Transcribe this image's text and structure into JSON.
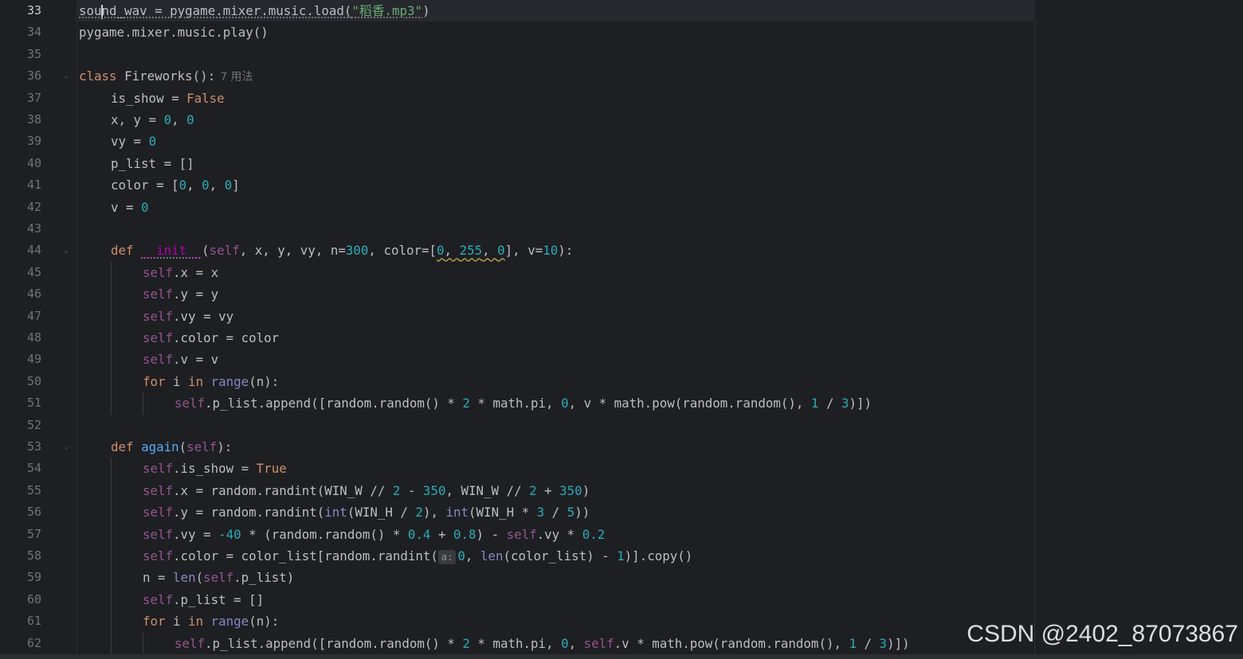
{
  "colors": {
    "background": "#1e1f22",
    "keyword": "#cf8e6d",
    "self": "#94558d",
    "number": "#2aacb8",
    "string": "#6aab73",
    "function_def": "#56a8f5",
    "builtin": "#8888c6",
    "magic_method": "#b200b2",
    "text": "#bcbec4"
  },
  "gutter": {
    "line_numbers": [
      "33",
      "34",
      "35",
      "36",
      "37",
      "38",
      "39",
      "40",
      "41",
      "42",
      "43",
      "44",
      "45",
      "46",
      "47",
      "48",
      "49",
      "50",
      "51",
      "52",
      "53",
      "54",
      "55",
      "56",
      "57",
      "58",
      "59",
      "60",
      "61",
      "62"
    ]
  },
  "inline_hints": {
    "usages": "7 用法",
    "param_a": "a:"
  },
  "code": {
    "l33": {
      "a": "sou",
      "b": "nd_wav = pygame.mixer.music.load(",
      "s": "\"稻香.mp3\"",
      "e": ")"
    },
    "l34": {
      "a": "pygame.mixer.music.play()"
    },
    "l36": {
      "kw": "class",
      "name": " Fireworks():"
    },
    "l37": {
      "a": "is_show = ",
      "v": "False"
    },
    "l38": {
      "a": "x, y = ",
      "n1": "0",
      "c": ", ",
      "n2": "0"
    },
    "l39": {
      "a": "vy = ",
      "n": "0"
    },
    "l40": {
      "a": "p_list = []"
    },
    "l41": {
      "a": "color = [",
      "n1": "0",
      "c1": ", ",
      "n2": "0",
      "c2": ", ",
      "n3": "0",
      "e": "]"
    },
    "l42": {
      "a": "v = ",
      "n": "0"
    },
    "l44": {
      "kw": "def",
      "sp": " ",
      "m": "__init__",
      "p1": "(",
      "self": "self",
      "p2": ", x, y, vy, n=",
      "n300": "300",
      "p3": ", color=[",
      "c0": "0",
      "cc": ", ",
      "c255": "255",
      "cc2": ", ",
      "c02": "0",
      "p4": "], v=",
      "n10": "10",
      "p5": "):"
    },
    "l45": {
      "self": "self",
      "a": ".x = x"
    },
    "l46": {
      "self": "self",
      "a": ".y = y"
    },
    "l47": {
      "self": "self",
      "a": ".vy = vy"
    },
    "l48": {
      "self": "self",
      "a": ".color = color"
    },
    "l49": {
      "self": "self",
      "a": ".v = v"
    },
    "l50": {
      "for": "for",
      "i": " i ",
      "in": "in",
      "sp": " ",
      "range": "range",
      "e": "(n):"
    },
    "l51": {
      "self": "self",
      "a": ".p_list.append([random.random() * ",
      "n2": "2",
      "b": " * math.pi, ",
      "n0": "0",
      "c": ", v * math.pow(random.random(), ",
      "n1": "1",
      "d": " / ",
      "n3": "3",
      "e": ")])"
    },
    "l53": {
      "kw": "def",
      "sp": " ",
      "fn": "again",
      "p": "(",
      "self": "self",
      "e": "):"
    },
    "l54": {
      "self": "self",
      "a": ".is_show = ",
      "v": "True"
    },
    "l55": {
      "self": "self",
      "a": ".x = random.randint(WIN_W // ",
      "n2": "2",
      "b": " - ",
      "n350": "350",
      "c": ", WIN_W // ",
      "n2b": "2",
      "d": " + ",
      "n350b": "350",
      "e": ")"
    },
    "l56": {
      "self": "self",
      "a": ".y = random.randint(",
      "int1": "int",
      "b": "(WIN_H / ",
      "n2": "2",
      "c": "), ",
      "int2": "int",
      "d": "(WIN_H * ",
      "n3": "3",
      "f": " / ",
      "n5": "5",
      "e": "))"
    },
    "l57": {
      "self": "self",
      "a": ".vy = ",
      "n40": "-40",
      "b": " * (random.random() * ",
      "n04": "0.4",
      "c": " + ",
      "n08": "0.8",
      "d": ") - ",
      "self2": "self",
      "f": ".vy * ",
      "n02": "0.2"
    },
    "l58": {
      "self": "self",
      "a": ".color = color_list[random.randint(",
      "n0": "0",
      "c": ", ",
      "len": "len",
      "d": "(color_list) - ",
      "n1": "1",
      "e": ")].copy()"
    },
    "l59": {
      "a": "n = ",
      "len": "len",
      "p": "(",
      "self": "self",
      "e": ".p_list)"
    },
    "l60": {
      "self": "self",
      "a": ".p_list = []"
    },
    "l61": {
      "for": "for",
      "i": " i ",
      "in": "in",
      "sp": " ",
      "range": "range",
      "e": "(n):"
    },
    "l62": {
      "self": "self",
      "a": ".p_list.append([random.random() * ",
      "n2": "2",
      "b": " * math.pi, ",
      "n0": "0",
      "c": ", ",
      "self2": "self",
      "d": ".v * math.pow(random.random(), ",
      "n1": "1",
      "f": " / ",
      "n3": "3",
      "e": ")])"
    }
  },
  "watermark": "CSDN @2402_87073867"
}
